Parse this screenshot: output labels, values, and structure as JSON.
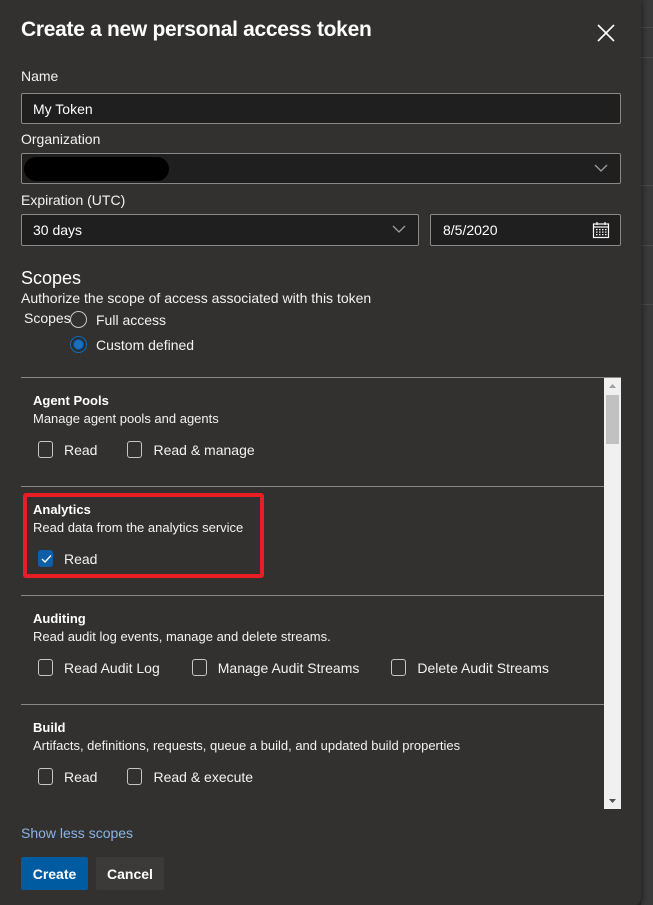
{
  "dialog": {
    "title": "Create a new personal access token",
    "close_icon": "close-icon"
  },
  "form": {
    "name_label": "Name",
    "name_value": "My Token",
    "organization_label": "Organization",
    "organization_value": "",
    "expiration_label": "Expiration (UTC)",
    "expiration_value": "30 days",
    "date_value": "8/5/2020"
  },
  "scopes": {
    "title": "Scopes",
    "description": "Authorize the scope of access associated with this token",
    "radio_group_label": "Scopes",
    "options": [
      {
        "label": "Full access",
        "selected": false
      },
      {
        "label": "Custom defined",
        "selected": true
      }
    ],
    "groups": [
      {
        "name": "Agent Pools",
        "description": "Manage agent pools and agents",
        "permissions": [
          {
            "label": "Read",
            "checked": false
          },
          {
            "label": "Read & manage",
            "checked": false
          }
        ]
      },
      {
        "name": "Analytics",
        "description": "Read data from the analytics service",
        "highlighted": true,
        "permissions": [
          {
            "label": "Read",
            "checked": true
          }
        ]
      },
      {
        "name": "Auditing",
        "description": "Read audit log events, manage and delete streams.",
        "permissions": [
          {
            "label": "Read Audit Log",
            "checked": false
          },
          {
            "label": "Manage Audit Streams",
            "checked": false
          },
          {
            "label": "Delete Audit Streams",
            "checked": false
          }
        ]
      },
      {
        "name": "Build",
        "description": "Artifacts, definitions, requests, queue a build, and updated build properties",
        "permissions": [
          {
            "label": "Read",
            "checked": false
          },
          {
            "label": "Read & execute",
            "checked": false
          }
        ]
      }
    ],
    "toggle_link": "Show less scopes"
  },
  "actions": {
    "create_label": "Create",
    "cancel_label": "Cancel"
  },
  "colors": {
    "primary": "#005ba1",
    "highlight": "#e81e25",
    "link": "#89b4e6",
    "background": "#323130"
  }
}
